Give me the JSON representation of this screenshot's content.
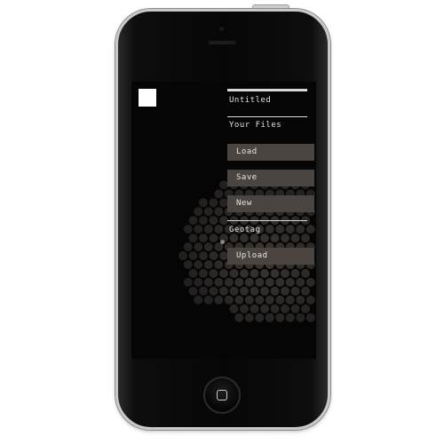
{
  "menu": {
    "title": "Untitled",
    "section": "Your Files",
    "buttons": {
      "load": "Load",
      "save": "Save",
      "new": "New",
      "upload": "Upload"
    },
    "geotag": "Geotag"
  },
  "background": {
    "faint_lines": [
      "",
      "",
      "",
      ""
    ]
  },
  "icons": {
    "logo": "white-square-logo",
    "home": "home-button-icon"
  },
  "colors": {
    "screen_bg": "#050505",
    "button_bg": "#4a4541",
    "dot_color": "#3a3633",
    "text": "#e0e0e0"
  }
}
